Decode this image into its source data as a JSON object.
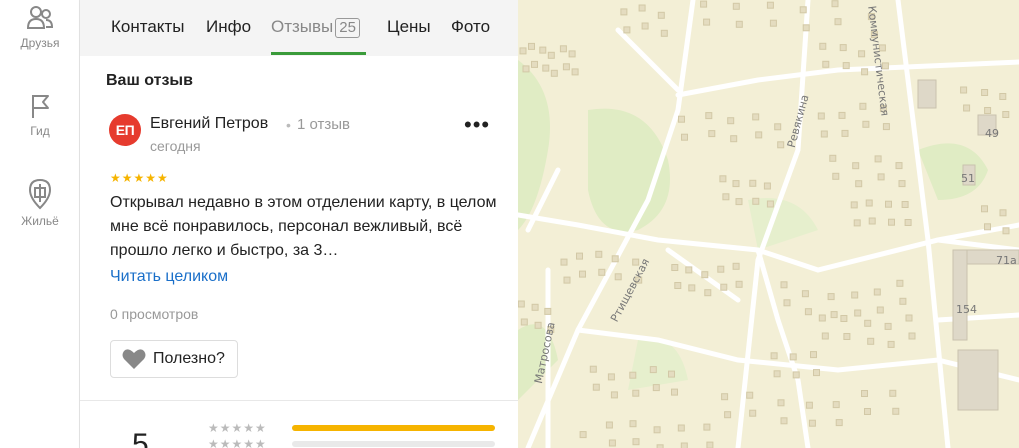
{
  "rail": {
    "items": [
      {
        "label": "Друзья",
        "icon": "friends-icon"
      },
      {
        "label": "Гид",
        "icon": "flag-icon"
      },
      {
        "label": "Жильё",
        "icon": "housing-icon"
      }
    ]
  },
  "tabs": [
    {
      "label": "Контакты"
    },
    {
      "label": "Инфо"
    },
    {
      "label": "Отзывы",
      "count": "25",
      "active": true
    },
    {
      "label": "Цены"
    },
    {
      "label": "Фото"
    }
  ],
  "section_title": "Ваш отзыв",
  "review": {
    "avatar_initials": "ЕП",
    "avatar_color": "#e63b2e",
    "author": "Евгений Петров",
    "author_reviews": "1 отзыв",
    "date": "сегодня",
    "rating": 5,
    "text": "Открывал недавно в этом отделении карту, в целом мне всё понравилось, персонал вежливый, всё прошло легко и быстро, за 3…",
    "read_more": "Читать целиком",
    "views": "0 просмотров",
    "helpful_label": "Полезно?"
  },
  "rating_summary": {
    "big_value": "5",
    "rows": [
      {
        "stars": 5,
        "fraction": 1.0
      },
      {
        "stars": 4,
        "fraction": 0.0
      }
    ]
  },
  "map": {
    "streets": [
      "Коммунистическая",
      "Ревякина",
      "Ртищевская",
      "Матросова"
    ],
    "house_numbers": [
      "49",
      "51",
      "71а",
      "154"
    ]
  },
  "colors": {
    "accent_green": "#3a9b3a",
    "link_blue": "#1a6fc9",
    "star_yellow": "#f6b400",
    "map_bg": "#f3efd6"
  }
}
